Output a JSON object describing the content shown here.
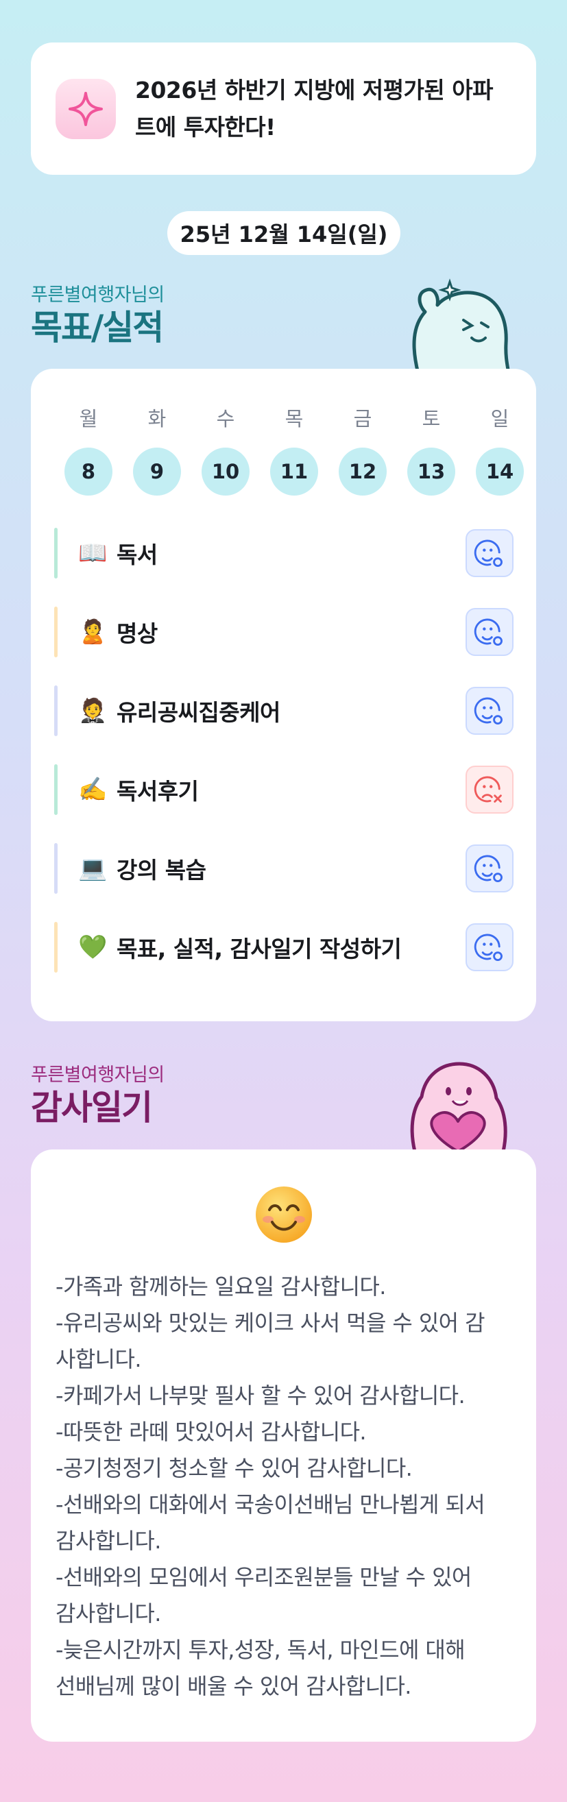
{
  "goal": {
    "icon": "sparkle-icon",
    "text": "2026년 하반기 지방에 저평가된 아파트에 투자한다!"
  },
  "date": "25년 12월 14일(일)",
  "goals_section": {
    "subtitle": "푸른별여행자님의",
    "title": "목표/실적"
  },
  "weekdays": [
    "월",
    "화",
    "수",
    "목",
    "금",
    "토",
    "일"
  ],
  "days": [
    "8",
    "9",
    "10",
    "11",
    "12",
    "13",
    "14"
  ],
  "tasks": [
    {
      "emoji": "📖",
      "label": "독서",
      "bar_color": "#b8ead8",
      "status": "done"
    },
    {
      "emoji": "🙎",
      "label": "명상",
      "bar_color": "#fde3b6",
      "status": "done"
    },
    {
      "emoji": "🤵",
      "label": "유리공씨집중케어",
      "bar_color": "#d6dcf7",
      "status": "done"
    },
    {
      "emoji": "✍️",
      "label": "독서후기",
      "bar_color": "#b8ead8",
      "status": "not-done"
    },
    {
      "emoji": "💻",
      "label": "강의 복습",
      "bar_color": "#d6dcf7",
      "status": "done"
    },
    {
      "emoji": "💚",
      "label": "목표, 실적, 감사일기 작성하기",
      "bar_color": "#fde3b6",
      "status": "done"
    }
  ],
  "gratitude_section": {
    "subtitle": "푸른별여행자님의",
    "title": "감사일기"
  },
  "gratitude": {
    "emoji": "😊",
    "lines": [
      "-가족과 함께하는 일요일 감사합니다.",
      "-유리공씨와 맛있는 케이크 사서 먹을 수 있어 감",
      "사합니다.",
      "-카페가서 나부맞 필사 할 수 있어 감사합니다.",
      "-따뜻한 라떼 맛있어서 감사합니다.",
      "-공기청정기 청소할 수 있어 감사합니다.",
      "-선배와의 대화에서 국송이선배님 만나뵙게 되서",
      "감사합니다.",
      "-선배와의 모임에서 우리조원분들 만날 수 있어",
      "감사합니다.",
      "-늦은시간까지 투자,성장, 독서, 마인드에 대해",
      "선배님께 많이 배울 수 있어 감사합니다."
    ]
  },
  "colors": {
    "accent_teal": "#1b7480",
    "accent_plum": "#7a1d63",
    "done_blue": "#3b6cf0",
    "not_done_red": "#ef5a5a"
  }
}
